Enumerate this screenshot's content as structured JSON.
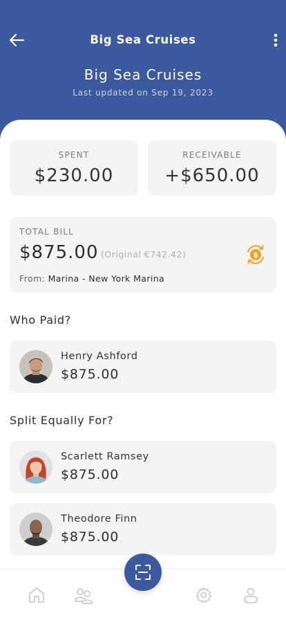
{
  "header": {
    "nav_title": "Big Sea Cruises",
    "title": "Big Sea Cruises",
    "updated": "Last updated on Sep 19, 2023"
  },
  "stats": {
    "spent_label": "SPENT",
    "spent_value": "$230.00",
    "receivable_label": "RECEIVABLE",
    "receivable_value": "+$650.00"
  },
  "bill": {
    "label": "TOTAL BILL",
    "amount": "$875.00",
    "original": "(Original €742.42)",
    "from_label": "From:",
    "from_value": "Marina - New York Marina"
  },
  "who_paid": {
    "title": "Who Paid?",
    "people": [
      {
        "name": "Henry Ashford",
        "amount": "$875.00"
      }
    ]
  },
  "split": {
    "title": "Split Equally For?",
    "people": [
      {
        "name": "Scarlett Ramsey",
        "amount": "$875.00"
      },
      {
        "name": "Theodore Finn",
        "amount": "$875.00"
      }
    ]
  },
  "tabbar": {
    "icons": [
      "home-icon",
      "group-icon",
      "scan-icon",
      "settings-icon",
      "profile-icon"
    ]
  },
  "colors": {
    "brand": "#3b5a9e",
    "card": "#f4f4f5",
    "coin": "#f0a21f"
  }
}
